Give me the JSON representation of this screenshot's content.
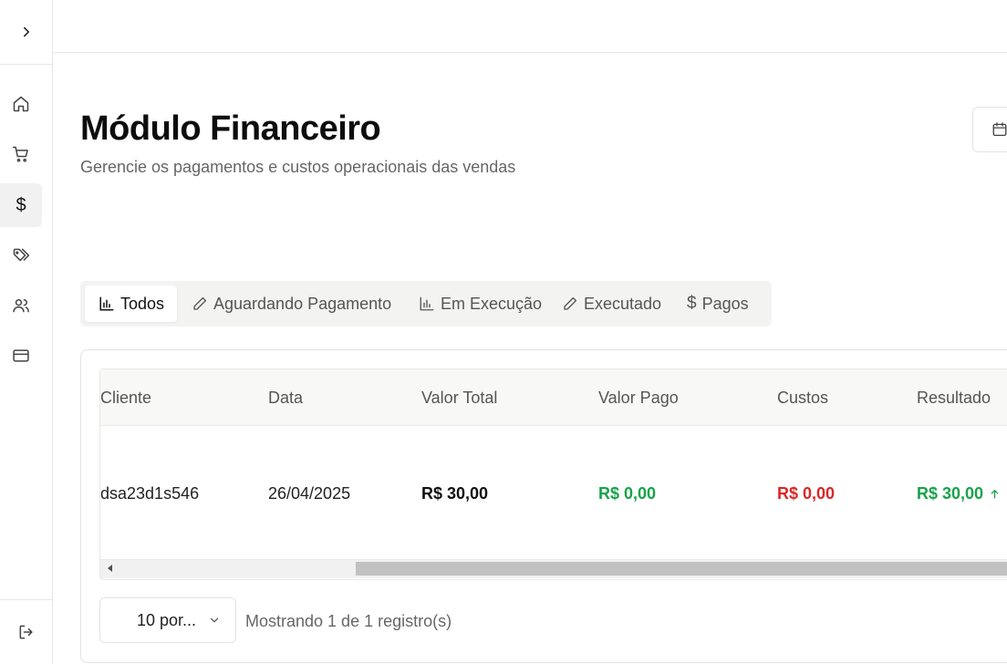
{
  "sidebar": {
    "toggle_icon": "chevron-right-icon",
    "items": [
      {
        "icon": "home-icon",
        "active": false
      },
      {
        "icon": "shopping-cart-icon",
        "active": false
      },
      {
        "icon": "dollar-icon",
        "glyph": "$",
        "active": true
      },
      {
        "icon": "tags-icon",
        "active": false
      },
      {
        "icon": "users-icon",
        "active": false
      },
      {
        "icon": "credit-card-icon",
        "active": false
      }
    ],
    "logout_icon": "log-out-icon"
  },
  "header": {
    "title": "Módulo Financeiro",
    "subtitle": "Gerencie os pagamentos e custos operacionais das vendas",
    "date_icon": "calendar-icon"
  },
  "tabs": [
    {
      "label": "Todos",
      "icon": "bar-chart-icon",
      "active": true
    },
    {
      "label": "Aguardando Pagamento",
      "icon": "pencil-icon",
      "active": false
    },
    {
      "label": "Em Execução",
      "icon": "bar-chart-icon",
      "active": false
    },
    {
      "label": "Executado",
      "icon": "pencil-icon",
      "active": false
    },
    {
      "label": "Pagos",
      "icon": "dollar-icon",
      "active": false
    }
  ],
  "table": {
    "columns": [
      "Cliente",
      "Data",
      "Valor Total",
      "Valor Pago",
      "Custos",
      "Resultado"
    ],
    "rows": [
      {
        "cliente": "dsa23d1s546",
        "data": "26/04/2025",
        "valor_total": "R$ 30,00",
        "valor_pago": "R$ 0,00",
        "custos": "R$ 0,00",
        "resultado": "R$ 30,00",
        "resultado_icon": "arrow-up-icon"
      }
    ]
  },
  "pagination": {
    "page_size": "10 por...",
    "info": "Mostrando 1 de 1 registro(s)"
  },
  "colors": {
    "positive": "#16a34a",
    "negative": "#dc2626",
    "active_bg": "#f1f1f1",
    "border": "#e6e6e6"
  }
}
